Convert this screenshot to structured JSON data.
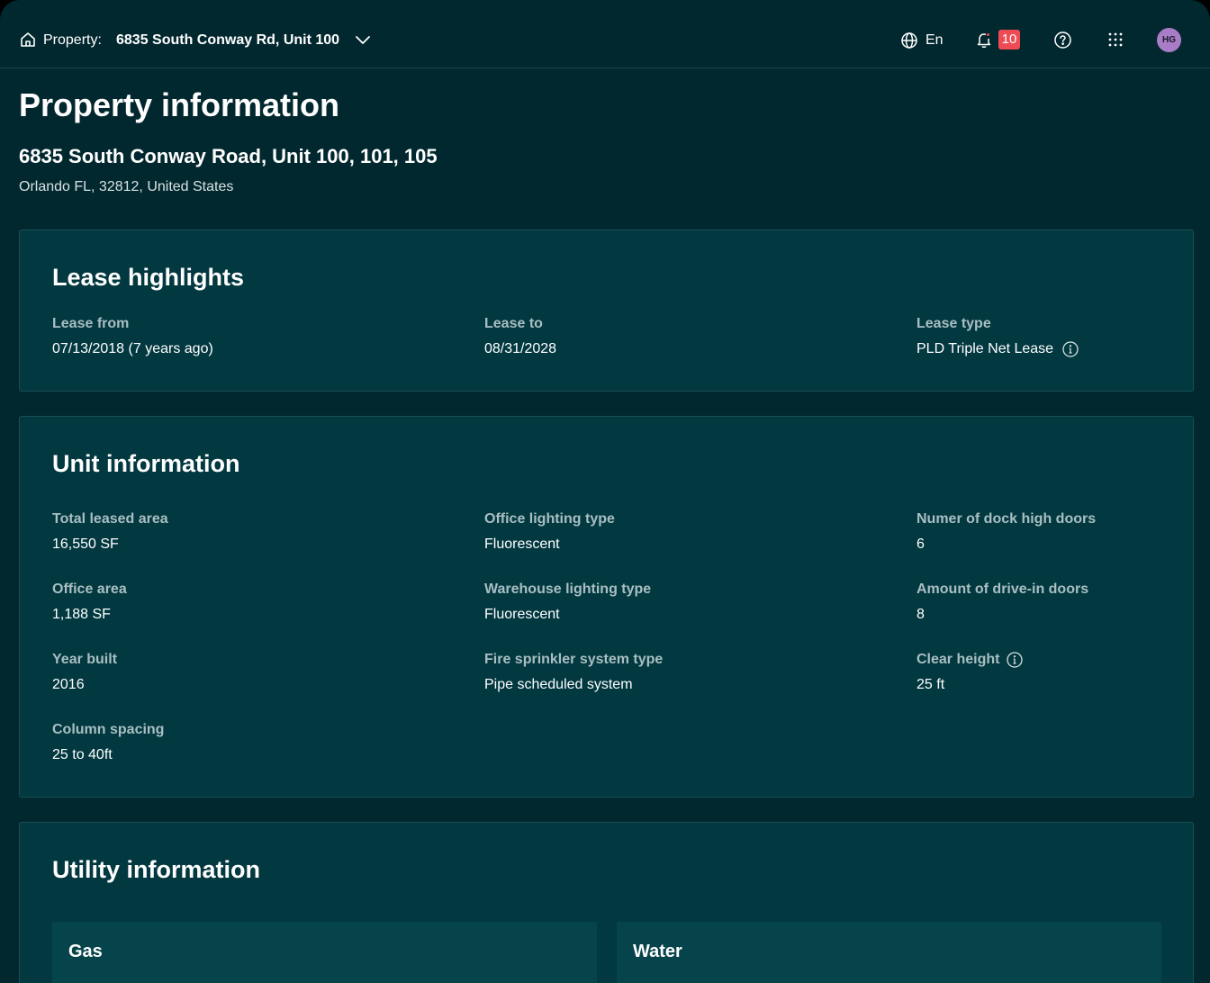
{
  "header": {
    "property_label": "Property:",
    "property_value": "6835 South Conway Rd, Unit 100",
    "language": "En",
    "notification_count": "10",
    "avatar_initials": "HG"
  },
  "page": {
    "title": "Property information",
    "address_line1": "6835 South Conway Road, Unit 100, 101, 105",
    "address_line2": "Orlando FL, 32812, United States"
  },
  "lease": {
    "title": "Lease highlights",
    "fields": [
      {
        "label": "Lease from",
        "value": "07/13/2018 (7 years ago)"
      },
      {
        "label": "Lease to",
        "value": "08/31/2028"
      },
      {
        "label": "Lease type",
        "value": "PLD Triple Net Lease"
      }
    ]
  },
  "unit": {
    "title": "Unit information",
    "fields": [
      {
        "label": "Total leased area",
        "value": "16,550 SF"
      },
      {
        "label": "Office lighting type",
        "value": "Fluorescent"
      },
      {
        "label": "Numer of dock high doors",
        "value": "6"
      },
      {
        "label": "Office area",
        "value": "1,188 SF"
      },
      {
        "label": "Warehouse lighting type",
        "value": "Fluorescent"
      },
      {
        "label": "Amount of drive-in doors",
        "value": "8"
      },
      {
        "label": "Year built",
        "value": "2016"
      },
      {
        "label": "Fire sprinkler system type",
        "value": "Pipe scheduled system"
      },
      {
        "label": "Clear height",
        "value": "25 ft"
      },
      {
        "label": "Column spacing",
        "value": "25 to 40ft"
      }
    ]
  },
  "utility": {
    "title": "Utility information",
    "sections": [
      {
        "title": "Gas"
      },
      {
        "title": "Water"
      }
    ]
  },
  "colors": {
    "background": "#02282f",
    "card": "#023840",
    "badge": "#ef4b55",
    "avatar": "#a97cc6"
  }
}
